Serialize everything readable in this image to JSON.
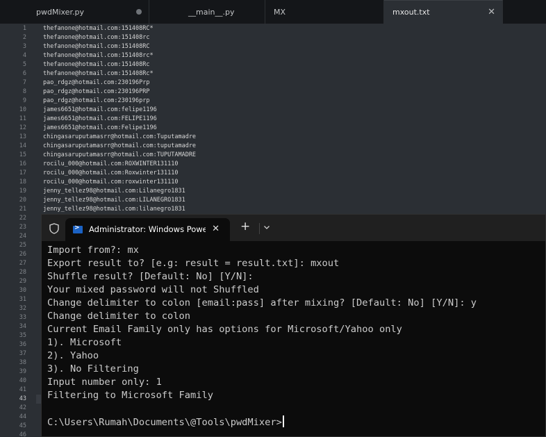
{
  "editor": {
    "tabs": [
      {
        "label": "pwdMixer.py",
        "modified": true
      },
      {
        "label": "__main__.py"
      },
      {
        "label": "MX"
      },
      {
        "label": "mxout.txt",
        "active": true
      }
    ],
    "lines": [
      "thefanone@hotmail.com:151408RC*",
      "thefanone@hotmail.com:151408rc",
      "thefanone@hotmail.com:151408RC",
      "thefanone@hotmail.com:151408rc*",
      "thefanone@hotmail.com:151408Rc",
      "thefanone@hotmail.com:151408Rc*",
      "pao_rdgz@hotmail.com:230196Prp",
      "pao_rdgz@hotmail.com:230196PRP",
      "pao_rdgz@hotmail.com:230196prp",
      "james6651@hotmail.com:felipe1196",
      "james6651@hotmail.com:FELIPE1196",
      "james6651@hotmail.com:Felipe1196",
      "chingasaruputamasrr@hotmail.com:Tuputamadre",
      "chingasaruputamasrr@hotmail.com:tuputamadre",
      "chingasaruputamasrr@hotmail.com:TUPUTAMADRE",
      "rocilu_000@hotmail.com:ROXWINTER131110",
      "rocilu_000@hotmail.com:Roxwinter131110",
      "rocilu_000@hotmail.com:roxwinter131110",
      "jenny_tellez98@hotmail.com:Lilanegro1831",
      "jenny_tellez98@hotmail.com:LILANEGRO1831",
      "jenny_tellez98@hotmail.com:lilanegro1831"
    ],
    "line_numbers": [
      "1",
      "2",
      "3",
      "4",
      "5",
      "6",
      "7",
      "8",
      "9",
      "10",
      "11",
      "12",
      "13",
      "14",
      "15",
      "16",
      "17",
      "18",
      "19",
      "20",
      "21",
      "22",
      "23",
      "24",
      "25",
      "26",
      "27",
      "28",
      "29",
      "30",
      "31",
      "32",
      "33",
      "34",
      "35",
      "36",
      "37",
      "38",
      "39",
      "40",
      "41",
      "43",
      "42",
      "44",
      "45",
      "46"
    ],
    "current_line": "43"
  },
  "terminal": {
    "tab_title": "Administrator: Windows PowerShell",
    "new_tab": "+",
    "close": "✕",
    "lines": [
      "Import from?: mx",
      "Export result to? [e.g: result = result.txt]: mxout",
      "Shuffle result? [Default: No] [Y/N]:",
      "Your mixed password will not Shuffled",
      "Change delimiter to colon [email:pass] after mixing? [Default: No] [Y/N]: y",
      "Change delimiter to colon",
      "Current Email Family only has options for Microsoft/Yahoo only",
      "1). Microsoft",
      "2). Yahoo",
      "3). No Filtering",
      "Input number only: 1",
      "Filtering to Microsoft Family"
    ],
    "prompt": "C:\\Users\\Rumah\\Documents\\@Tools\\pwdMixer>"
  },
  "icons": {
    "tab_close": "close-icon",
    "modified": "modified-dot-icon",
    "shield": "shield-icon",
    "powershell": "powershell-icon",
    "dropdown": "chevron-down-icon"
  }
}
